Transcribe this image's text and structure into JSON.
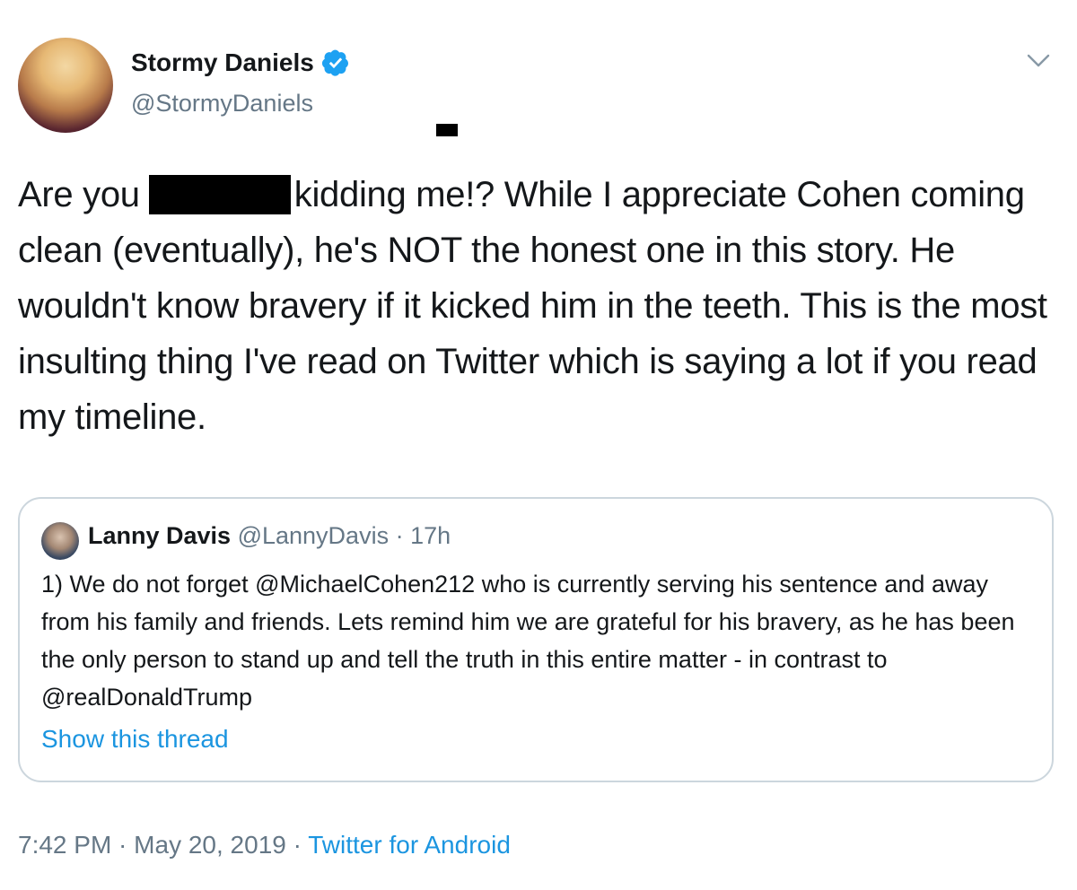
{
  "author": {
    "name": "Stormy Daniels",
    "handle": "@StormyDaniels"
  },
  "tweet": {
    "text_before_redaction": "Are you",
    "text_after_redaction": "kidding me!? While I appreciate Cohen coming clean (eventually), he's NOT the honest one in this story. He wouldn't know bravery if it kicked him in the teeth. This is the most insulting thing I've read on Twitter which is saying a lot if you read my timeline."
  },
  "quoted_tweet": {
    "name": "Lanny Davis",
    "handle": "@LannyDavis",
    "separator": " · ",
    "age": "17h",
    "text": "1) We do not forget @MichaelCohen212 who is currently serving his sentence and away from his family and friends. Lets remind him we are grateful for his bravery, as he has been the only person to stand up and tell the truth in this entire matter - in contrast to @realDonaldTrump",
    "show_thread": "Show this thread"
  },
  "footer": {
    "time": "7:42 PM",
    "separator": " · ",
    "date": "May 20, 2019",
    "source": "Twitter for Android"
  },
  "icons": {
    "verified": "verified-badge-icon",
    "menu": "chevron-down-icon"
  },
  "colors": {
    "link": "#1b95e0",
    "secondary_text": "#657786",
    "verified": "#1da1f2",
    "border": "#ccd6dd"
  }
}
